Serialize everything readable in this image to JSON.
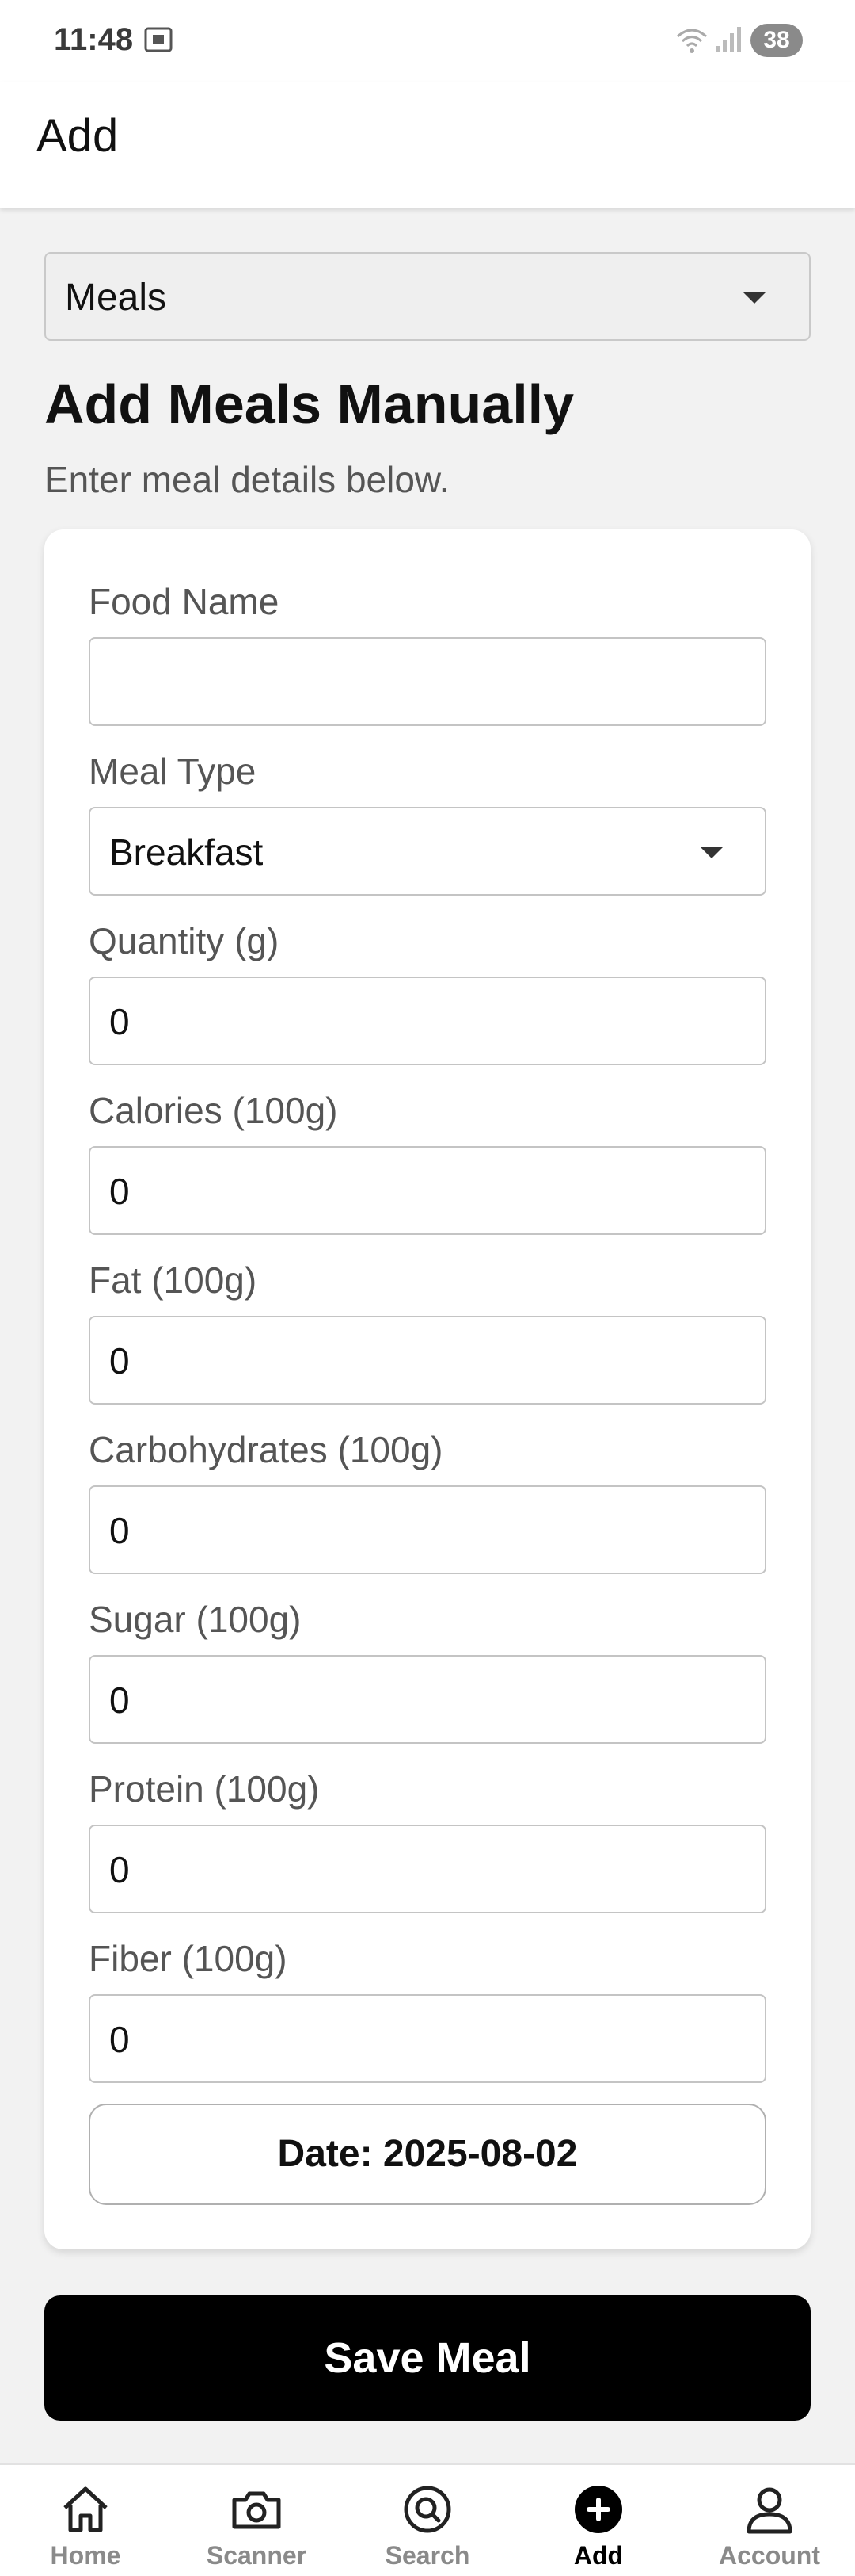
{
  "status_bar": {
    "time": "11:48",
    "battery": "38"
  },
  "app_bar": {
    "title": "Add"
  },
  "category_select": {
    "value": "Meals"
  },
  "heading": "Add Meals Manually",
  "subheading": "Enter meal details below.",
  "form": {
    "food_name": {
      "label": "Food Name",
      "value": ""
    },
    "meal_type": {
      "label": "Meal Type",
      "value": "Breakfast"
    },
    "fields": [
      {
        "label": "Quantity (g)",
        "value": "0"
      },
      {
        "label": "Calories (100g)",
        "value": "0"
      },
      {
        "label": "Fat (100g)",
        "value": "0"
      },
      {
        "label": "Carbohydrates (100g)",
        "value": "0"
      },
      {
        "label": "Sugar (100g)",
        "value": "0"
      },
      {
        "label": "Protein (100g)",
        "value": "0"
      },
      {
        "label": "Fiber (100g)",
        "value": "0"
      }
    ],
    "date_button": "Date: 2025-08-02"
  },
  "save_button": "Save Meal",
  "bottom_nav": {
    "items": [
      {
        "label": "Home",
        "icon": "home-icon"
      },
      {
        "label": "Scanner",
        "icon": "camera-icon"
      },
      {
        "label": "Search",
        "icon": "search-icon"
      },
      {
        "label": "Add",
        "icon": "add-circle-icon",
        "active": true
      },
      {
        "label": "Account",
        "icon": "account-icon"
      }
    ]
  },
  "colors": {
    "background": "#f2f2f2",
    "card": "#ffffff",
    "primary_button": "#000000",
    "nav_inactive": "#8a8a8a",
    "nav_active": "#000000"
  }
}
